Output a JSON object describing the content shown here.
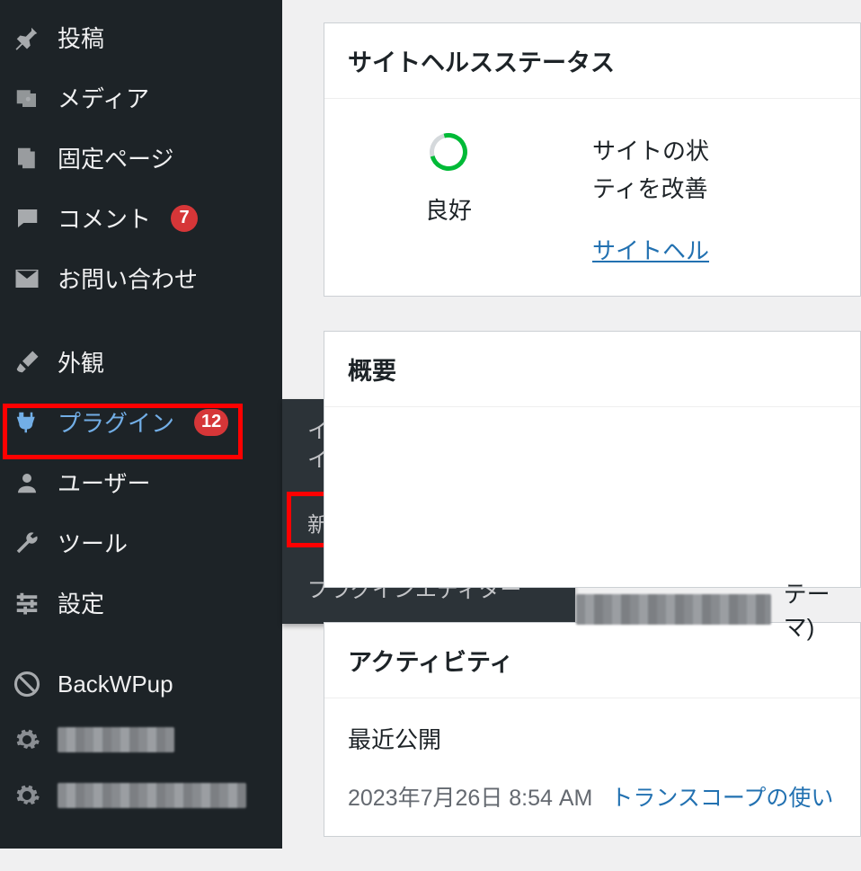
{
  "sidebar": {
    "items": [
      {
        "label": "投稿",
        "icon": "pin"
      },
      {
        "label": "メディア",
        "icon": "media"
      },
      {
        "label": "固定ページ",
        "icon": "page"
      },
      {
        "label": "コメント",
        "icon": "comment",
        "badge": "7"
      },
      {
        "label": "お問い合わせ",
        "icon": "mail"
      },
      {
        "label": "外観",
        "icon": "brush"
      },
      {
        "label": "プラグイン",
        "icon": "plug",
        "badge": "12",
        "current": true
      },
      {
        "label": "ユーザー",
        "icon": "user"
      },
      {
        "label": "ツール",
        "icon": "wrench"
      },
      {
        "label": "設定",
        "icon": "sliders"
      },
      {
        "label": "BackWPup",
        "icon": "backwpup"
      }
    ]
  },
  "flyout": {
    "items": [
      "インストール済みプラグイン",
      "新規追加",
      "プラグインエディター"
    ]
  },
  "health": {
    "title": "サイトヘルスステータス",
    "status": "良好",
    "desc1": "サイトの状",
    "desc2": "ティを改善",
    "link": "サイトヘル"
  },
  "overview": {
    "title": "概要",
    "theme_suffix": "テーマ)"
  },
  "activity": {
    "title": "アクティビティ",
    "recent": "最近公開",
    "date": "2023年7月26日 8:54 AM",
    "post": "トランスコープの使い"
  }
}
